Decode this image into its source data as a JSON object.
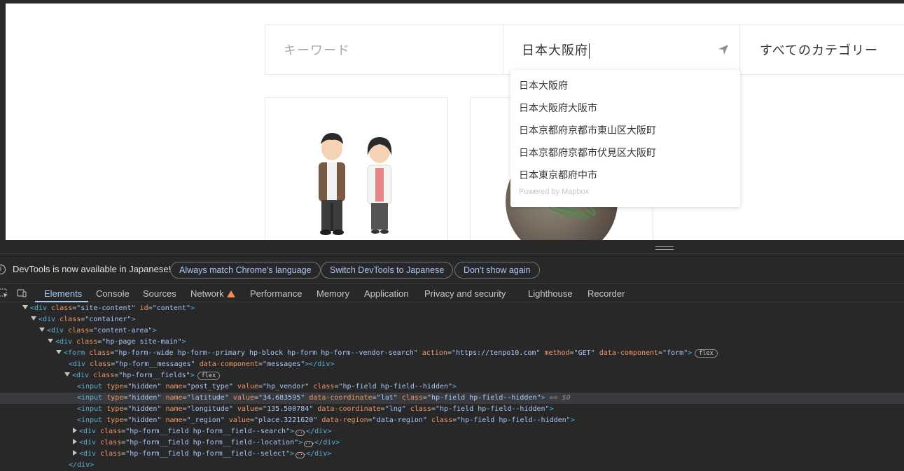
{
  "page": {
    "keyword_placeholder": "キーワード",
    "location_value": "日本大阪府",
    "category_value": "すべてのカテゴリー",
    "suggestions": [
      "日本大阪府",
      "日本大阪府大阪市",
      "日本京都府京都市東山区大阪町",
      "日本京都府京都市伏見区大阪町",
      "日本東京都府中市"
    ],
    "powered_by": "Powered by Mapbox"
  },
  "infobar": {
    "message": "DevTools is now available in Japanese!",
    "btn_match": "Always match Chrome's language",
    "btn_switch": "Switch DevTools to Japanese",
    "btn_dont_show": "Don't show again"
  },
  "tabs": [
    "Elements",
    "Console",
    "Sources",
    "Network",
    "Performance",
    "Memory",
    "Application",
    "Privacy and security",
    "Lighthouse",
    "Recorder"
  ],
  "tree": {
    "l0": {
      "tag": "div",
      "class": "site-content",
      "id": "content"
    },
    "l1": {
      "tag": "div",
      "class": "container"
    },
    "l2": {
      "tag": "div",
      "class": "content-area"
    },
    "l3": {
      "tag": "div",
      "class": "hp-page site-main"
    },
    "l4": {
      "tag": "form",
      "class": "hp-form--wide hp-form--primary hp-block hp-form hp-form--vendor-search",
      "action": "https://tenpo10.com",
      "method": "GET",
      "data_component": "form",
      "badge": "flex"
    },
    "l5": {
      "tag": "div",
      "class": "hp-form__messages",
      "data_component": "messages"
    },
    "l6": {
      "tag": "div",
      "class": "hp-form__fields",
      "badge": "flex"
    },
    "l7": {
      "type": "hidden",
      "name": "post_type",
      "value": "hp_vendor",
      "class": "hp-field hp-field--hidden"
    },
    "l8": {
      "type": "hidden",
      "name": "latitude",
      "value": "34.683595",
      "data_coordinate": "lat",
      "class": "hp-field hp-field--hidden",
      "eq": "== $0"
    },
    "l9": {
      "type": "hidden",
      "name": "longitude",
      "value": "135.500784",
      "data_coordinate": "lng",
      "class": "hp-field hp-field--hidden"
    },
    "l10": {
      "type": "hidden",
      "name": "_region",
      "value": "place.3221620",
      "data_region": "data-region",
      "class": "hp-field hp-field--hidden"
    },
    "l11": {
      "class": "hp-form__field hp-form__field--search"
    },
    "l12": {
      "class": "hp-form__field hp-form__field--location"
    },
    "l13": {
      "class": "hp-form__field hp-form__field--select"
    }
  }
}
